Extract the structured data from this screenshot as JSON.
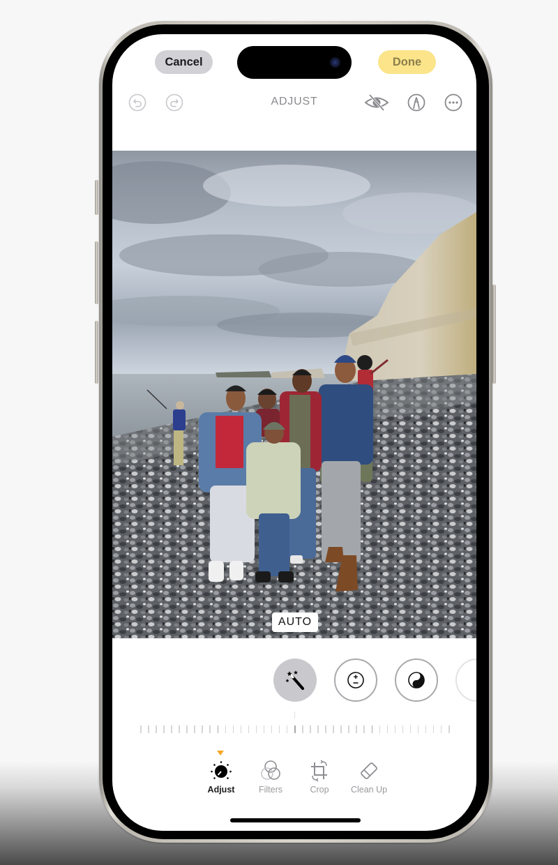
{
  "header": {
    "cancel_label": "Cancel",
    "done_label": "Done",
    "title": "ADJUST"
  },
  "toolbar_icons": {
    "left": [
      "undo-icon",
      "redo-icon"
    ],
    "right": [
      "hide-original-icon",
      "markup-icon",
      "more-icon"
    ]
  },
  "photo": {
    "description": "Family of five posing on a pebble beach beside white chalk cliffs under a cloudy sky",
    "auto_badge": "AUTO"
  },
  "adjust_tools": [
    {
      "name": "auto-enhance",
      "icon": "magic-wand-icon",
      "state": "active"
    },
    {
      "name": "exposure",
      "icon": "exposure-icon",
      "state": "inactive"
    },
    {
      "name": "brilliance",
      "icon": "brilliance-icon",
      "state": "inactive"
    },
    {
      "name": "next-tool",
      "icon": "partial-tool-icon",
      "state": "partial"
    }
  ],
  "slider": {
    "value_label": "",
    "position_fraction": 0.5
  },
  "bottom_tabs": [
    {
      "label": "Adjust",
      "icon": "adjust-dial-icon",
      "active": true
    },
    {
      "label": "Filters",
      "icon": "filters-icon",
      "active": false
    },
    {
      "label": "Crop",
      "icon": "crop-icon",
      "active": false
    },
    {
      "label": "Clean Up",
      "icon": "eraser-icon",
      "active": false
    }
  ],
  "colors": {
    "done_bg": "#fbe48a",
    "done_text": "#8d7f4c",
    "cancel_bg": "#d1d1d6",
    "tab_indicator": "#f5a623"
  }
}
